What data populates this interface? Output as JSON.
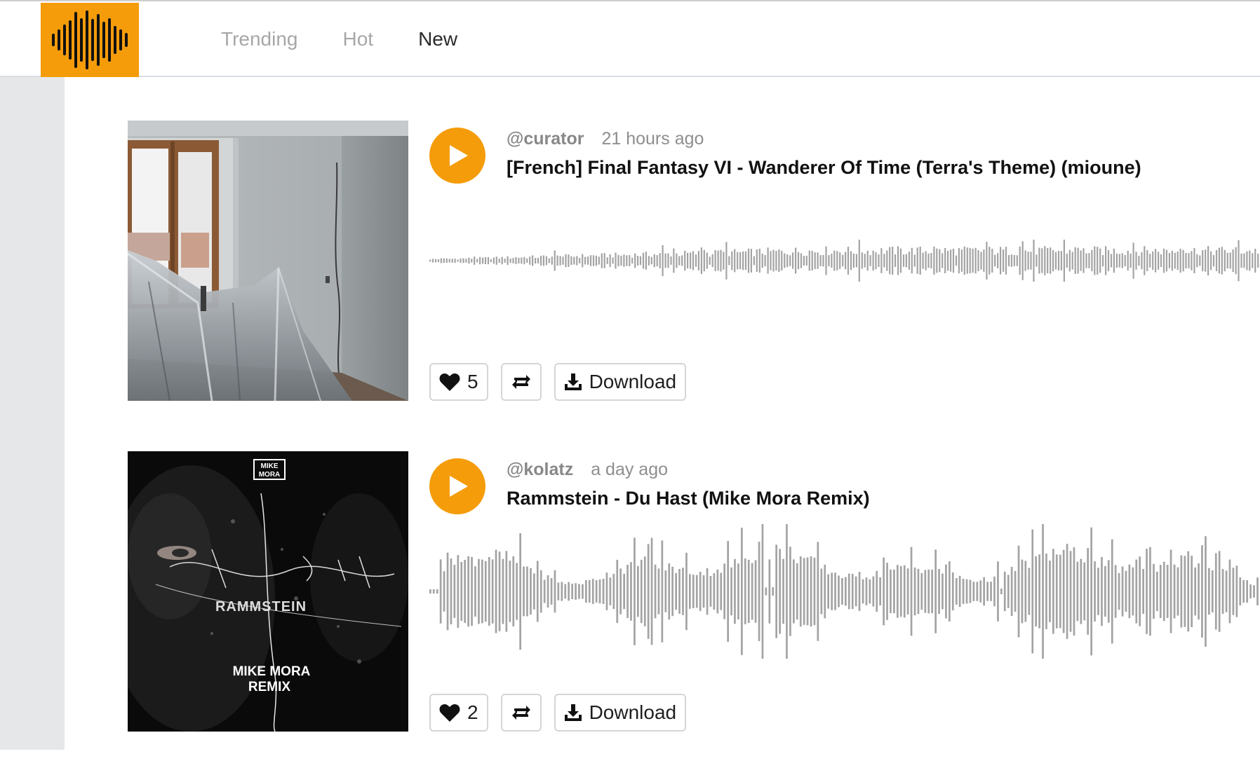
{
  "colors": {
    "accent": "#f59c0b",
    "waveform": "#a3a3a3"
  },
  "header": {
    "logo_icon": "waveform-logo-icon",
    "tabs": [
      {
        "label": "Trending",
        "active": false
      },
      {
        "label": "Hot",
        "active": false
      },
      {
        "label": "New",
        "active": true
      }
    ]
  },
  "feed": {
    "tracks": [
      {
        "user": "@curator",
        "time": "21 hours ago",
        "title": "[French] Final Fantasy VI - Wanderer Of Time (Terra's Theme) (mioune)",
        "likes": "5",
        "download_label": "Download",
        "cover_icon": "room-photo-cover"
      },
      {
        "user": "@kolatz",
        "time": "a day ago",
        "title": "Rammstein - Du Hast (Mike Mora Remix)",
        "likes": "2",
        "download_label": "Download",
        "cover_icon": "album-art-cover",
        "cover_text": {
          "logo": "MIKE MORA",
          "band": "RAMMSTEIN",
          "remix_line1": "MIKE MORA",
          "remix_line2": "REMIX"
        }
      }
    ]
  }
}
